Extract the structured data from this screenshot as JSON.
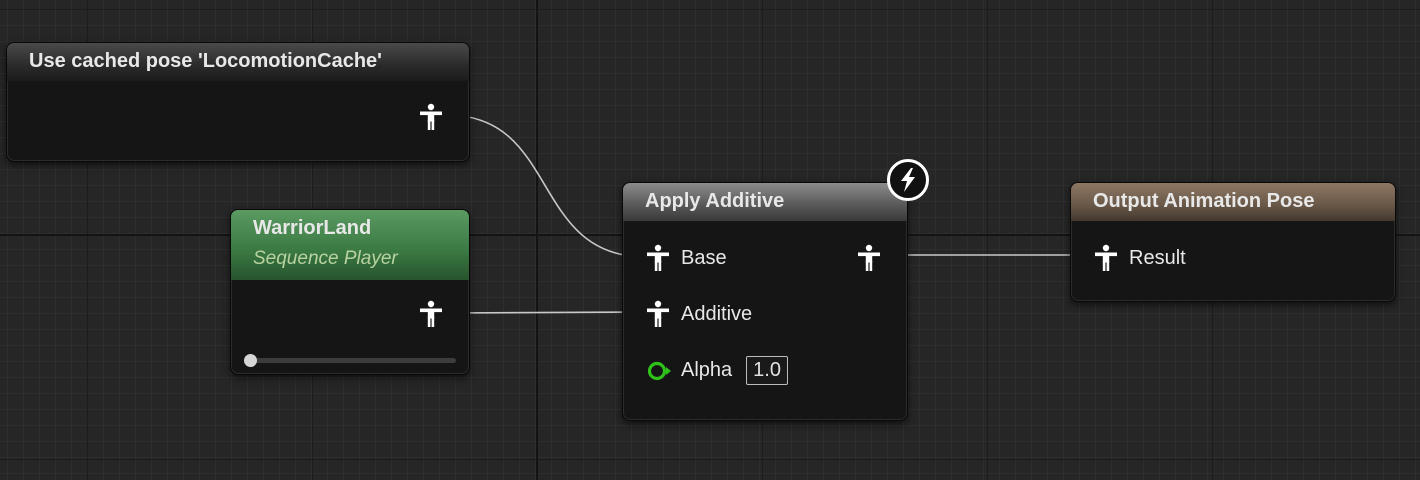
{
  "nodes": {
    "cached_pose": {
      "title": "Use cached pose 'LocomotionCache'"
    },
    "sequence_player": {
      "title": "WarriorLand",
      "subtitle": "Sequence Player",
      "playback_position": 0.0
    },
    "apply_additive": {
      "title": "Apply Additive",
      "pins": {
        "base": "Base",
        "additive": "Additive",
        "alpha": "Alpha",
        "alpha_value": "1.0"
      },
      "badge_icon": "lightning-bolt-icon"
    },
    "output_pose": {
      "title": "Output Animation Pose",
      "pins": {
        "result": "Result"
      }
    }
  },
  "colors": {
    "pose_pin": "#ffffff",
    "float_pin": "#2ec21a",
    "wire": "#c8c8c8",
    "header_sequence_player": "#3a7842",
    "header_output": "#6b5a4a",
    "header_apply_additive": "#5b5b5b"
  },
  "icons": {
    "pose_pin": "pose-pin-icon",
    "float_pin": "float-pin-icon"
  }
}
